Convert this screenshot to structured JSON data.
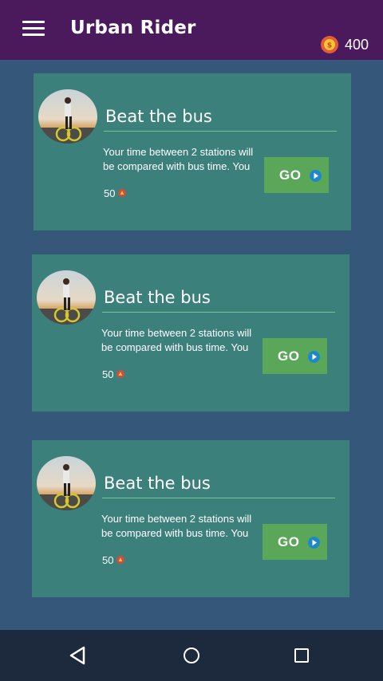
{
  "app": {
    "title": "Urban Rider",
    "coin_count": "400"
  },
  "icons": {
    "menu": "hamburger-menu-icon",
    "coin": "coin-icon",
    "trophy": "trophy-icon",
    "play": "play-arrow-icon",
    "back": "back-triangle-icon",
    "home": "home-circle-icon",
    "recent": "recent-apps-square-icon"
  },
  "colors": {
    "topbar": "#4a1a5c",
    "background": "#35577a",
    "card": "#3c807b",
    "go_button": "#5aa75a",
    "navbar": "#1d2a3d"
  },
  "challenges": [
    {
      "title": "Beat the bus",
      "desc_line1": "Your time between 2 stations will",
      "desc_line2": "be compared with bus time. You",
      "reward": "50",
      "button": "GO"
    },
    {
      "title": "Beat the bus",
      "desc_line1": "Your time between 2 stations will",
      "desc_line2": "be compared with bus time. You",
      "reward": "50",
      "button": "GO"
    },
    {
      "title": "Beat the bus",
      "desc_line1": "Your time between 2 stations will",
      "desc_line2": "be compared with bus time. You",
      "reward": "50",
      "button": "GO"
    }
  ]
}
